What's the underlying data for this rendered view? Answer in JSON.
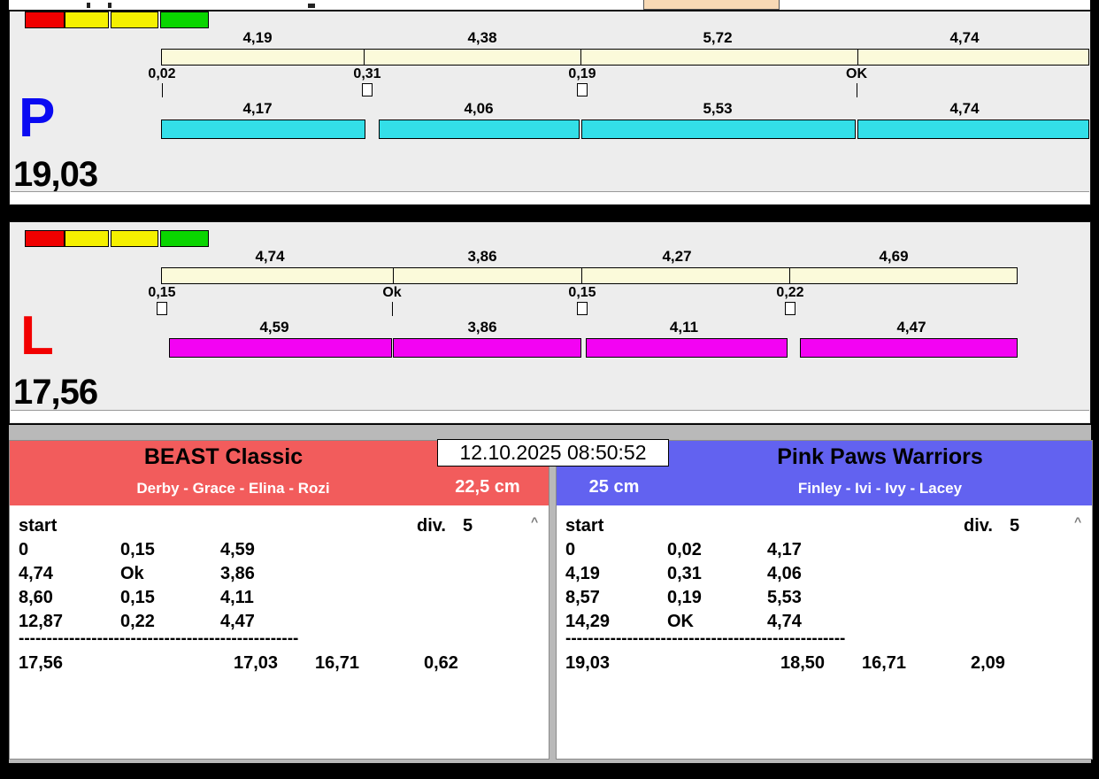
{
  "datetime": "12.10.2025 08:50:52",
  "scroll": {
    "up_arrow": "^"
  },
  "lanes": [
    {
      "letter": "P",
      "letter_color": "#0a0af2",
      "run_color": "#33dfe8",
      "total": "19,03",
      "lights": [
        "#f00000",
        "#f5f000",
        "#f5f000",
        "#0ad500"
      ],
      "splits": [
        "4,19",
        "4,38",
        "5,72",
        "4,74"
      ],
      "marks": [
        "0,02",
        "0,31",
        "0,19",
        "OK"
      ],
      "runs": [
        "4,17",
        "4,06",
        "5,53",
        "4,74"
      ]
    },
    {
      "letter": "L",
      "letter_color": "#f20000",
      "run_color": "#f303f3",
      "total": "17,56",
      "lights": [
        "#f00000",
        "#f5f000",
        "#f5f000",
        "#0ad500"
      ],
      "splits": [
        "4,74",
        "3,86",
        "4,27",
        "4,69"
      ],
      "marks": [
        "0,15",
        "Ok",
        "0,15",
        "0,22"
      ],
      "runs": [
        "4,59",
        "3,86",
        "4,11",
        "4,47"
      ]
    }
  ],
  "teams": [
    {
      "name": "BEAST Classic",
      "members": "Derby - Grace - Elina - Rozi",
      "jump_height": "22,5 cm",
      "header_color": "#f25c5c",
      "start_label": "start",
      "div_label": "div.",
      "division": "5",
      "rows": [
        [
          "0",
          "0,15",
          "4,59"
        ],
        [
          "4,74",
          "Ok",
          "3,86"
        ],
        [
          "8,60",
          "0,15",
          "4,11"
        ],
        [
          "12,87",
          "0,22",
          "4,47"
        ]
      ],
      "separator": "--------------------------------------------------",
      "totals": [
        "17,56",
        "17,03",
        "16,71",
        "0,62"
      ]
    },
    {
      "name": "Pink Paws Warriors",
      "members": "Finley - Ivi - Ivy - Lacey",
      "jump_height": "25 cm",
      "header_color": "#6262f0",
      "start_label": "start",
      "div_label": "div.",
      "division": "5",
      "rows": [
        [
          "0",
          "0,02",
          "4,17"
        ],
        [
          "4,19",
          "0,31",
          "4,06"
        ],
        [
          "8,57",
          "0,19",
          "5,53"
        ],
        [
          "14,29",
          "OK",
          "4,74"
        ]
      ],
      "separator": "--------------------------------------------------",
      "totals": [
        "19,03",
        "18,50",
        "16,71",
        "2,09"
      ]
    }
  ]
}
